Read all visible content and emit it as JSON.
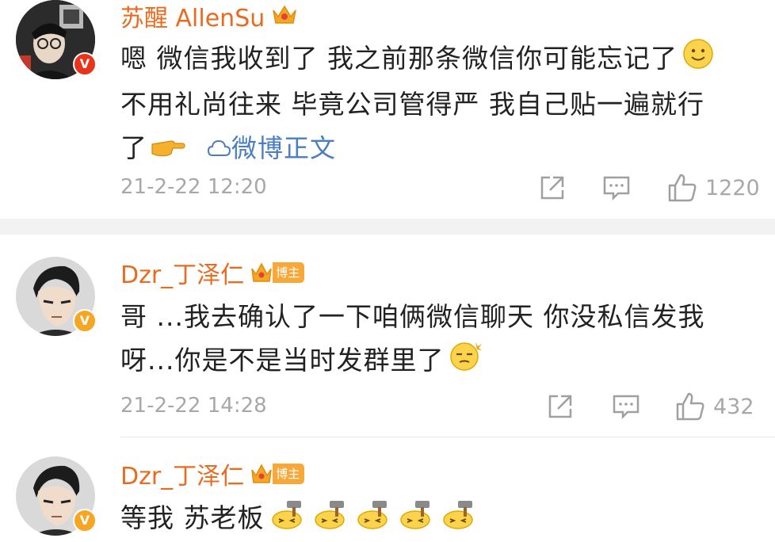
{
  "comments": [
    {
      "username": "苏醒 AllenSu",
      "line1": "嗯 微信我收到了 我之前那条微信你可能忘记了",
      "line2": "不用礼尚往来 毕竟公司管得严 我自己贴一遍就行",
      "line3": "了",
      "link_label": "微博正文",
      "time": "21-2-22 12:20",
      "likes": "1220",
      "badge_letter": "V",
      "accent_color": "#e86b1f"
    },
    {
      "username": "Dzr_丁泽仁",
      "host_label": "博主",
      "line1": "哥 ...我去确认了一下咱俩微信聊天 你没私信发我",
      "line2": "呀...你是不是当时发群里了",
      "time": "21-2-22 14:28",
      "likes": "432",
      "badge_letter": "V"
    },
    {
      "username": "Dzr_丁泽仁",
      "host_label": "博主",
      "line1": "等我 苏老板",
      "badge_letter": "V"
    }
  ],
  "icons": [
    "crown-icon",
    "smile-emoji-icon",
    "pointing-hand-emoji-icon",
    "link-icon",
    "share-icon",
    "comment-icon",
    "like-icon",
    "sleepy-emoji-icon",
    "hammer-emoji-icon"
  ]
}
